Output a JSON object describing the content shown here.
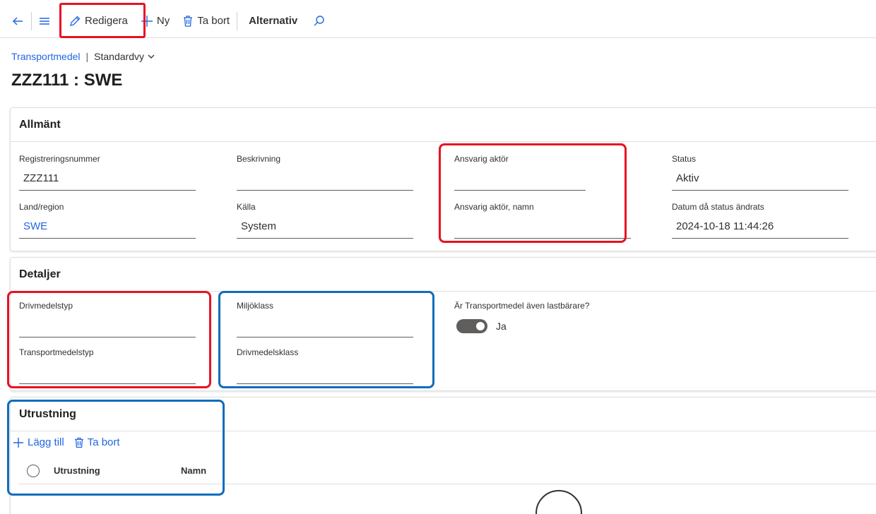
{
  "toolbar": {
    "back_icon": "back-arrow-icon",
    "menu_icon": "hamburger-icon",
    "edit_label": "Redigera",
    "new_label": "Ny",
    "delete_label": "Ta bort",
    "options_label": "Alternativ",
    "search_icon": "search-icon"
  },
  "breadcrumb": {
    "link": "Transportmedel",
    "separator": "|",
    "view": "Standardvy"
  },
  "page_title": "ZZZ111 : SWE",
  "general": {
    "header": "Allmänt",
    "registration_label": "Registreringsnummer",
    "registration_value": "ZZZ111",
    "description_label": "Beskrivning",
    "description_value": "",
    "responsible_label": "Ansvarig aktör",
    "responsible_value": "",
    "status_label": "Status",
    "status_value": "Aktiv",
    "country_label": "Land/region",
    "country_value": "SWE",
    "source_label": "Källa",
    "source_value": "System",
    "responsible_name_label": "Ansvarig aktör, namn",
    "responsible_name_value": "",
    "status_date_label": "Datum då status ändrats",
    "status_date_value": "2024-10-18 11:44:26"
  },
  "details": {
    "header": "Detaljer",
    "fuel_type_label": "Drivmedelstyp",
    "fuel_type_value": "",
    "environment_class_label": "Miljöklass",
    "environment_class_value": "",
    "cargo_carrier_label": "Är Transportmedel även lastbärare?",
    "cargo_carrier_value": "Ja",
    "transport_type_label": "Transportmedelstyp",
    "transport_type_value": "",
    "fuel_class_label": "Drivmedelsklass",
    "fuel_class_value": ""
  },
  "equipment": {
    "header": "Utrustning",
    "add_label": "Lägg till",
    "delete_label": "Ta bort",
    "col_equipment": "Utrustning",
    "col_name": "Namn"
  },
  "colors": {
    "accent": "#2266e3",
    "annotation_red": "#e81123",
    "annotation_blue": "#0f6cbd"
  }
}
